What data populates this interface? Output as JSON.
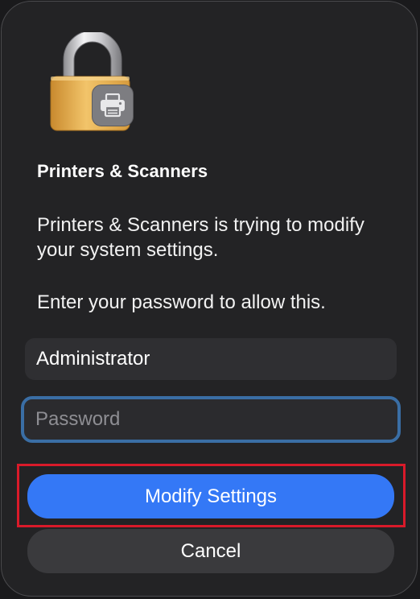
{
  "dialog": {
    "title": "Printers & Scanners",
    "message": "Printers & Scanners is trying to modify your system settings.",
    "prompt": "Enter your password to allow this.",
    "lock_icon": "padlock-icon",
    "badge_icon": "printer-icon"
  },
  "username_field": {
    "value": "Administrator"
  },
  "password_field": {
    "placeholder": "Password",
    "value": ""
  },
  "buttons": {
    "primary_label": "Modify Settings",
    "secondary_label": "Cancel"
  },
  "colors": {
    "accent": "#3478f6",
    "focus_ring": "#3a6ea5",
    "highlight_box": "#d91a2a",
    "lock_gold": "#e3a84a"
  }
}
